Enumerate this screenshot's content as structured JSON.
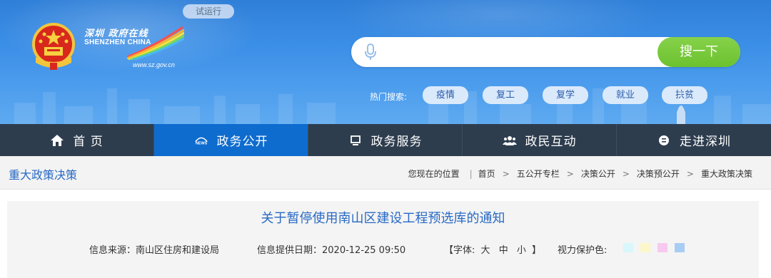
{
  "header": {
    "trial_badge": "试运行",
    "logo": {
      "cn_text": "深圳 政府在线",
      "en_text": "SHENZHEN CHINA",
      "url_text": "www.sz.gov.cn"
    },
    "search": {
      "placeholder": "",
      "button_label": "搜一下"
    },
    "hot_search": {
      "label": "热门搜索:",
      "tags": [
        "疫情",
        "复工",
        "复学",
        "就业",
        "扶贫"
      ]
    }
  },
  "nav": {
    "items": [
      {
        "label": "首 页",
        "icon": "home-icon"
      },
      {
        "label": "政务公开",
        "icon": "news-icon"
      },
      {
        "label": "政务服务",
        "icon": "monitor-icon"
      },
      {
        "label": "政民互动",
        "icon": "people-icon"
      },
      {
        "label": "走进深圳",
        "icon": "info-circle-icon"
      }
    ],
    "active_index": 1
  },
  "breadcrumb": {
    "section_title": "重大政策决策",
    "lead": "您现在的位置",
    "items": [
      "首页",
      "五公开专栏",
      "决策公开",
      "决策预公开",
      "重大政策决策"
    ],
    "separator": ">"
  },
  "article": {
    "title": "关于暂停使用南山区建设工程预选库的通知",
    "source": "信息来源：南山区住房和建设局",
    "date": "信息提供日期：2020-12-25 09:50",
    "font_size": {
      "open": "【字体:",
      "large": "大",
      "medium": "中",
      "small": "小",
      "close": "】"
    },
    "eye_care_label": "视力保护色:",
    "eye_care_colors": [
      "#d9f7fb",
      "#fbf7c8",
      "#f8c9f0",
      "#a8cdf4"
    ]
  },
  "colors": {
    "nav_bg": "#2e3d4e",
    "nav_active": "#0e6ccf",
    "search_button": "#6cc22f",
    "link_blue": "#2869c5"
  }
}
